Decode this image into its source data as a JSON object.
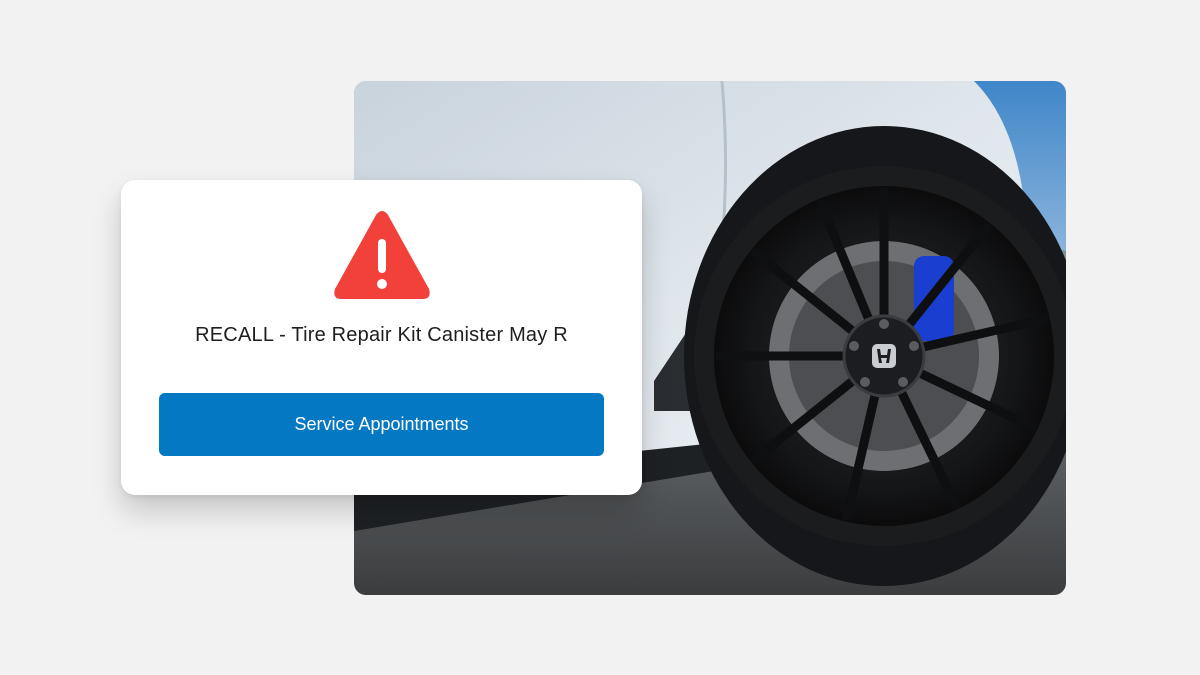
{
  "alert": {
    "icon": "warning-triangle-icon",
    "icon_color": "#f2403a",
    "title": "RECALL - Tire Repair Kit Canister May R"
  },
  "actions": {
    "service_label": "Service Appointments",
    "service_color": "#0478c3"
  },
  "photo": {
    "subject": "car-wheel-image",
    "brand_badge": "honda-logo-icon"
  }
}
